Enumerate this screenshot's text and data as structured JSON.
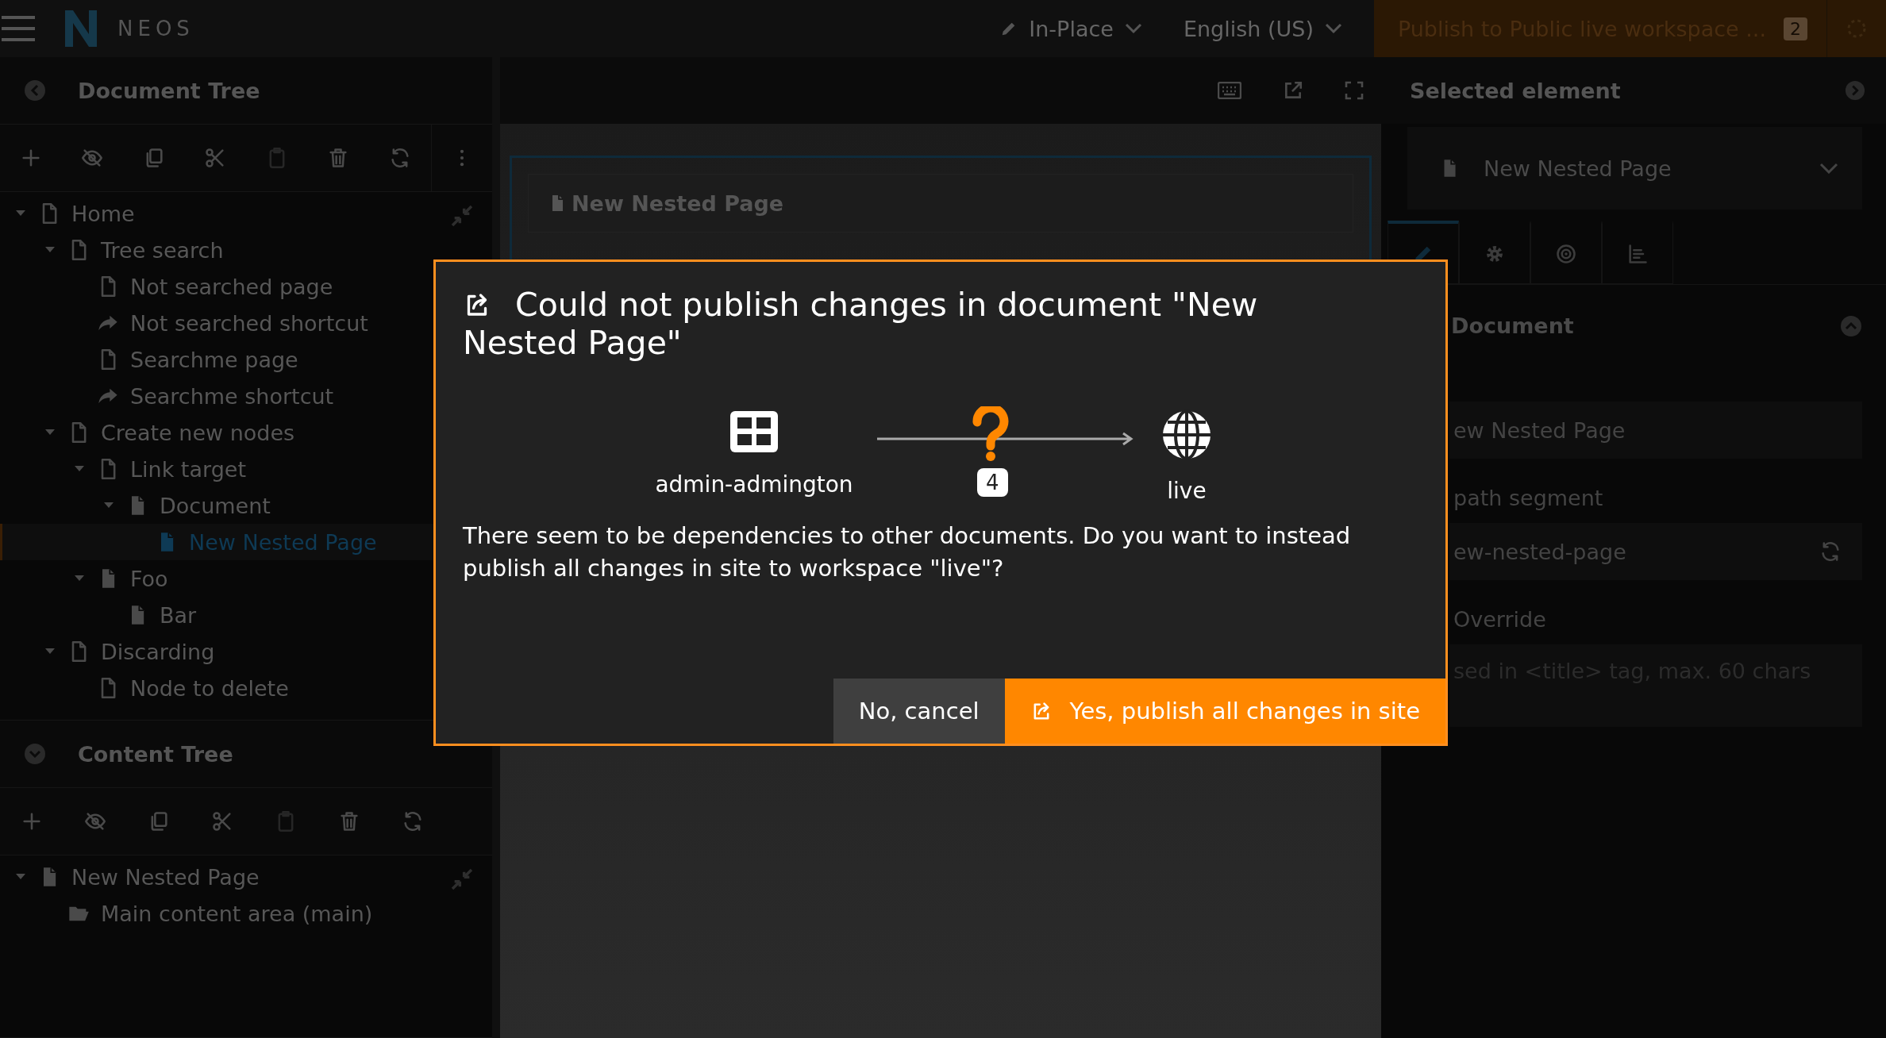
{
  "topbar": {
    "logo": "NEOS",
    "edit_mode": "In-Place",
    "language": "English (US)",
    "publish": {
      "label": "Publish to Public live workspace ...",
      "count": "2"
    }
  },
  "document_tree": {
    "title": "Document Tree",
    "toolbar": [
      {
        "kind": "add",
        "disabled": false
      },
      {
        "kind": "hide",
        "disabled": false
      },
      {
        "kind": "copy",
        "disabled": false
      },
      {
        "kind": "cut",
        "disabled": false
      },
      {
        "kind": "paste",
        "disabled": true
      },
      {
        "kind": "delete",
        "disabled": false
      },
      {
        "kind": "refresh",
        "disabled": false
      },
      {
        "kind": "more",
        "disabled": false
      }
    ],
    "items": [
      {
        "label": "Home",
        "kind": "page",
        "selected": false,
        "expanded": true,
        "children": [
          {
            "label": "Tree search",
            "kind": "page",
            "selected": false,
            "expanded": true,
            "children": [
              {
                "label": "Not searched page",
                "kind": "page",
                "selected": false
              },
              {
                "label": "Not searched shortcut",
                "kind": "shortcut",
                "selected": false
              },
              {
                "label": "Searchme page",
                "kind": "page",
                "selected": false
              },
              {
                "label": "Searchme shortcut",
                "kind": "shortcut",
                "selected": false
              }
            ]
          },
          {
            "label": "Create new nodes",
            "kind": "page",
            "selected": false,
            "expanded": true,
            "children": [
              {
                "label": "Link target",
                "kind": "page",
                "selected": false,
                "expanded": true,
                "children": [
                  {
                    "label": "Document",
                    "kind": "document",
                    "selected": false,
                    "expanded": true,
                    "children": [
                      {
                        "label": "New Nested Page",
                        "kind": "document",
                        "selected": true
                      }
                    ]
                  }
                ]
              },
              {
                "label": "Foo",
                "kind": "document",
                "selected": false,
                "expanded": true,
                "children": [
                  {
                    "label": "Bar",
                    "kind": "document",
                    "selected": false
                  }
                ]
              }
            ]
          },
          {
            "label": "Discarding",
            "kind": "page",
            "selected": false,
            "expanded": true,
            "children": [
              {
                "label": "Node to delete",
                "kind": "page",
                "selected": false
              }
            ]
          }
        ]
      }
    ]
  },
  "content_tree": {
    "title": "Content Tree",
    "toolbar": [
      {
        "kind": "add",
        "disabled": false
      },
      {
        "kind": "hide",
        "disabled": false
      },
      {
        "kind": "copy",
        "disabled": false
      },
      {
        "kind": "cut",
        "disabled": false
      },
      {
        "kind": "paste",
        "disabled": true
      },
      {
        "kind": "delete",
        "disabled": false
      },
      {
        "kind": "refresh",
        "disabled": false
      }
    ],
    "items": [
      {
        "label": "New Nested Page",
        "kind": "document",
        "selected": false,
        "expanded": true,
        "children": [
          {
            "label": "Main content area (main)",
            "kind": "collection",
            "selected": false
          }
        ]
      }
    ]
  },
  "preview": {
    "heading": "New Nested Page"
  },
  "inspector": {
    "title": "Selected element",
    "node": "New Nested Page",
    "tabs": [
      {
        "kind": "edit",
        "selected": true
      },
      {
        "kind": "settings",
        "selected": false
      },
      {
        "kind": "target",
        "selected": false
      },
      {
        "kind": "chart",
        "selected": false
      }
    ],
    "section": "Document",
    "fields": [
      {
        "kind": "input",
        "value": "ew Nested Page"
      },
      {
        "kind": "label",
        "text": "path segment"
      },
      {
        "kind": "input-refresh",
        "value": "ew-nested-page"
      },
      {
        "kind": "label",
        "text": "Override"
      },
      {
        "kind": "textarea",
        "placeholder": "sed in <title> tag, max. 60 chars"
      }
    ]
  },
  "dialog": {
    "title": "Could not publish changes in document \"New Nested Page\"",
    "source": "admin-admington",
    "count": "4",
    "target": "live",
    "message": "There seem to be dependencies to other documents. Do you want to instead publish all changes in site to workspace \"live\"?",
    "buttons": [
      {
        "kind": "cancel",
        "label": "No, cancel"
      },
      {
        "kind": "confirm",
        "label": "Yes, publish all changes in site"
      }
    ]
  }
}
